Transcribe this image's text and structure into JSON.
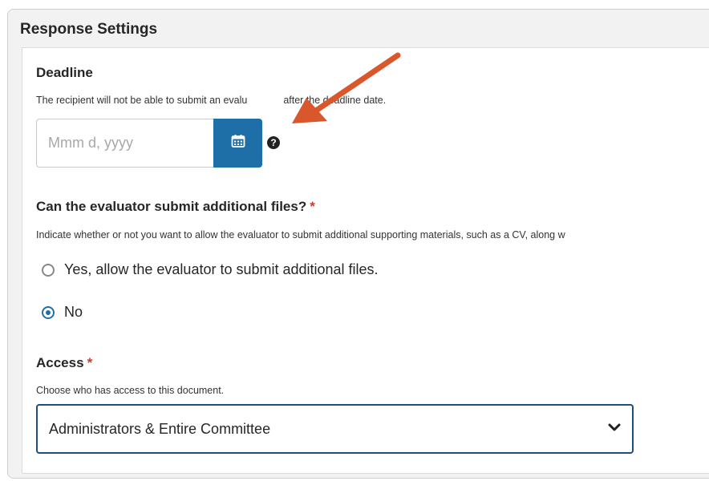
{
  "panel": {
    "title": "Response Settings"
  },
  "deadline": {
    "title": "Deadline",
    "help": "The recipient will not be able to submit an evalu",
    "help_tail": "after the deadline date.",
    "placeholder": "Mmm d, yyyy",
    "calendar_icon": "calendar-icon",
    "help_icon": "?"
  },
  "files": {
    "title": "Can the evaluator submit additional files?",
    "required": "*",
    "help": "Indicate whether or not you want to allow the evaluator to submit additional supporting materials, such as a CV, along w",
    "options": [
      {
        "label": "Yes, allow the evaluator to submit additional files.",
        "checked": false
      },
      {
        "label": "No",
        "checked": true
      }
    ]
  },
  "access": {
    "title": "Access",
    "required": "*",
    "help": "Choose who has access to this document.",
    "selected": "Administrators & Entire Committee"
  },
  "colors": {
    "accent": "#1e6fa8",
    "required": "#d33b2c",
    "annotation_arrow": "#d9572b"
  }
}
